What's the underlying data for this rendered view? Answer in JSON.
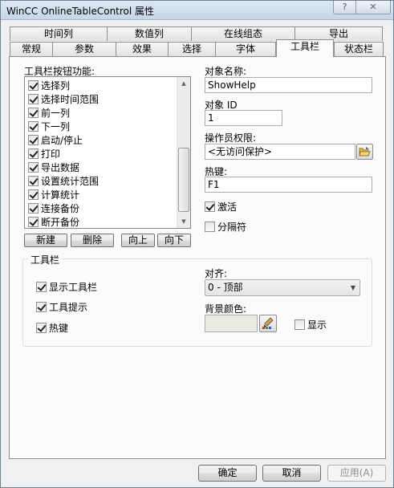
{
  "window": {
    "title": "WinCC OnlineTableControl 属性",
    "help_label": "?",
    "close_label": "✕"
  },
  "tabs_back": [
    "时间列",
    "数值列",
    "在线组态",
    "导出"
  ],
  "tabs_front": [
    "常规",
    "参数",
    "效果",
    "选择",
    "字体",
    "工具栏",
    "状态栏"
  ],
  "active_tab": "工具栏",
  "toolbar_functions": {
    "label": "工具栏按钮功能:",
    "items": [
      {
        "label": "选择列",
        "checked": true
      },
      {
        "label": "选择时间范围",
        "checked": true
      },
      {
        "label": "前一列",
        "checked": true
      },
      {
        "label": "下一列",
        "checked": true
      },
      {
        "label": "启动/停止",
        "checked": true
      },
      {
        "label": "打印",
        "checked": true
      },
      {
        "label": "导出数据",
        "checked": true
      },
      {
        "label": "设置统计范围",
        "checked": true
      },
      {
        "label": "计算统计",
        "checked": true
      },
      {
        "label": "连接备份",
        "checked": true
      },
      {
        "label": "断开备份",
        "checked": true
      }
    ],
    "buttons": {
      "new": "新建",
      "delete": "删除",
      "up": "向上",
      "down": "向下"
    }
  },
  "object": {
    "name_label": "对象名称:",
    "name_value": "ShowHelp",
    "id_label": "对象 ID",
    "id_value": "1",
    "permission_label": "操作员权限:",
    "permission_value": "<无访问保护>",
    "hotkey_label": "热键:",
    "hotkey_value": "F1",
    "activate_label": "激活",
    "activate_checked": true,
    "separator_label": "分隔符",
    "separator_checked": false
  },
  "toolbar_group": {
    "title": "工具栏",
    "show_toolbar": "显示工具栏",
    "tooltips": "工具提示",
    "hotkeys": "热键",
    "align_label": "对齐:",
    "align_value": "0 - 顶部",
    "bg_color_label": "背景颜色:",
    "bg_color": "#ecebe2",
    "show_label": "显示",
    "show_checked": false
  },
  "footer": {
    "ok": "确定",
    "cancel": "取消",
    "apply": "应用(A)"
  }
}
